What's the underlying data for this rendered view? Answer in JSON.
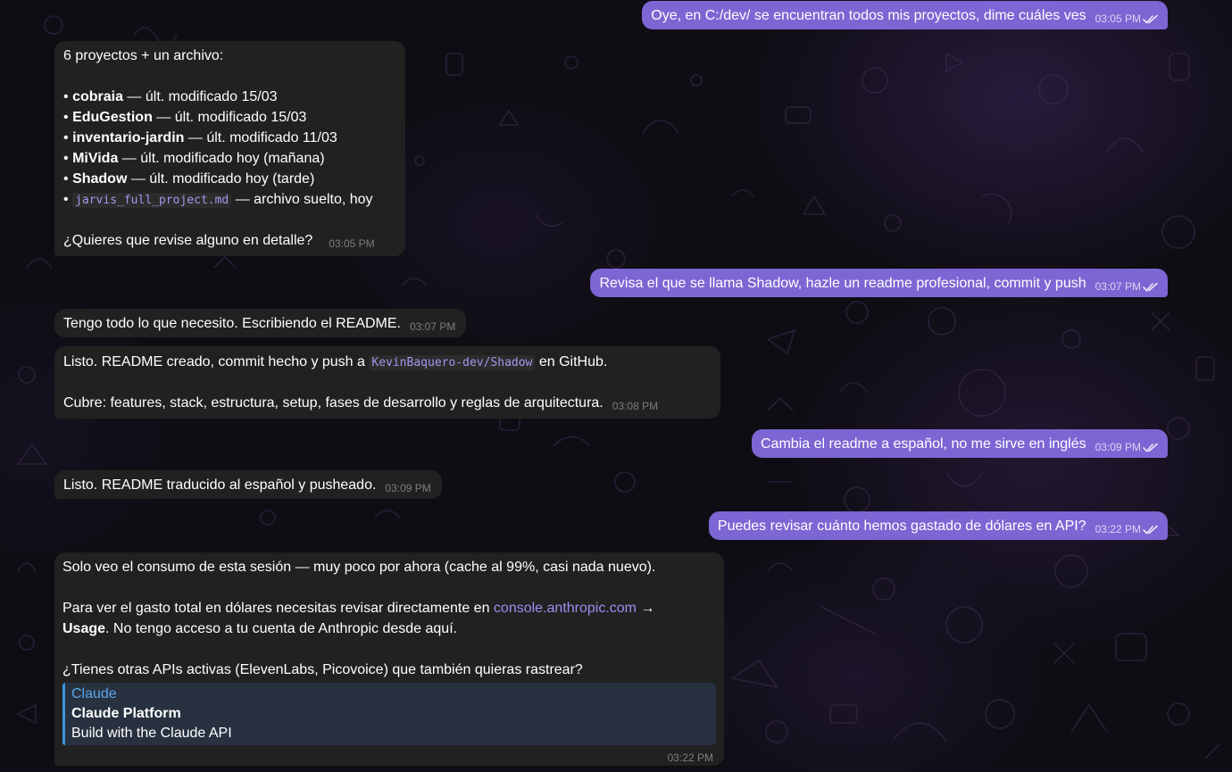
{
  "messages": [
    {
      "text": "Oye, en C:/dev/ se encuentran todos mis proyectos, dime cuáles ves",
      "time": "03:05 PM"
    },
    {
      "intro": "6 proyectos + un archivo:",
      "items": [
        {
          "name": "cobraia",
          "detail": " — últ. modificado 15/03"
        },
        {
          "name": "EduGestion",
          "detail": " — últ. modificado 15/03"
        },
        {
          "name": "inventario-jardin",
          "detail": " — últ. modificado 11/03"
        },
        {
          "name": "MiVida",
          "detail": " — últ. modificado hoy (mañana)"
        },
        {
          "name": "Shadow",
          "detail": " — últ. modificado hoy (tarde)"
        },
        {
          "code": "jarvis_full_project.md",
          "detail": " — archivo suelto, hoy"
        }
      ],
      "bullet": "•",
      "question": "¿Quieres que revise alguno en detalle?",
      "time": "03:05 PM"
    },
    {
      "text": "Revisa el que se llama Shadow, hazle un readme profesional, commit y push",
      "time": "03:07 PM"
    },
    {
      "text": "Tengo todo lo que necesito. Escribiendo el README.",
      "time": "03:07 PM"
    },
    {
      "before": "Listo. README creado, commit hecho y push a ",
      "code": "KevinBaquero-dev/Shadow",
      "after": " en GitHub.",
      "line2": "Cubre: features, stack, estructura, setup, fases de desarrollo y reglas de arquitectura.",
      "time": "03:08 PM"
    },
    {
      "text": "Cambia el readme a español, no me sirve en inglés",
      "time": "03:09 PM"
    },
    {
      "text": "Listo. README traducido al español y pusheado.",
      "time": "03:09 PM"
    },
    {
      "text": "Puedes revisar cuánto hemos gastado de dólares en API?",
      "time": "03:22 PM"
    },
    {
      "p1": "Solo veo el consumo de esta sesión — muy poco por ahora (cache al 99%, casi nada nuevo).",
      "p2_before": "Para ver el gasto total en dólares necesitas revisar directamente en ",
      "p2_link": "console.anthropic.com",
      "p2_arrow": " →",
      "p2_bold": "Usage",
      "p2_after": ". No tengo acceso a tu cuenta de Anthropic desde aquí.",
      "p3": "¿Tienes otras APIs activas (ElevenLabs, Picovoice) que también quieras rastrear?",
      "preview": {
        "site": "Claude",
        "title": "Claude Platform",
        "description": "Build with the Claude API"
      },
      "time": "03:22 PM"
    }
  ],
  "icons": {
    "read_receipt": "double-check-icon",
    "background": "doodle-pattern"
  },
  "colors": {
    "outgoing_bubble": "#7c66d3",
    "incoming_bubble": "#212121",
    "link": "#9e8cf0",
    "code": "#a894ee",
    "preview_bar": "#3d94e0",
    "preview_bg": "#283140",
    "background": "#0f0d14"
  }
}
